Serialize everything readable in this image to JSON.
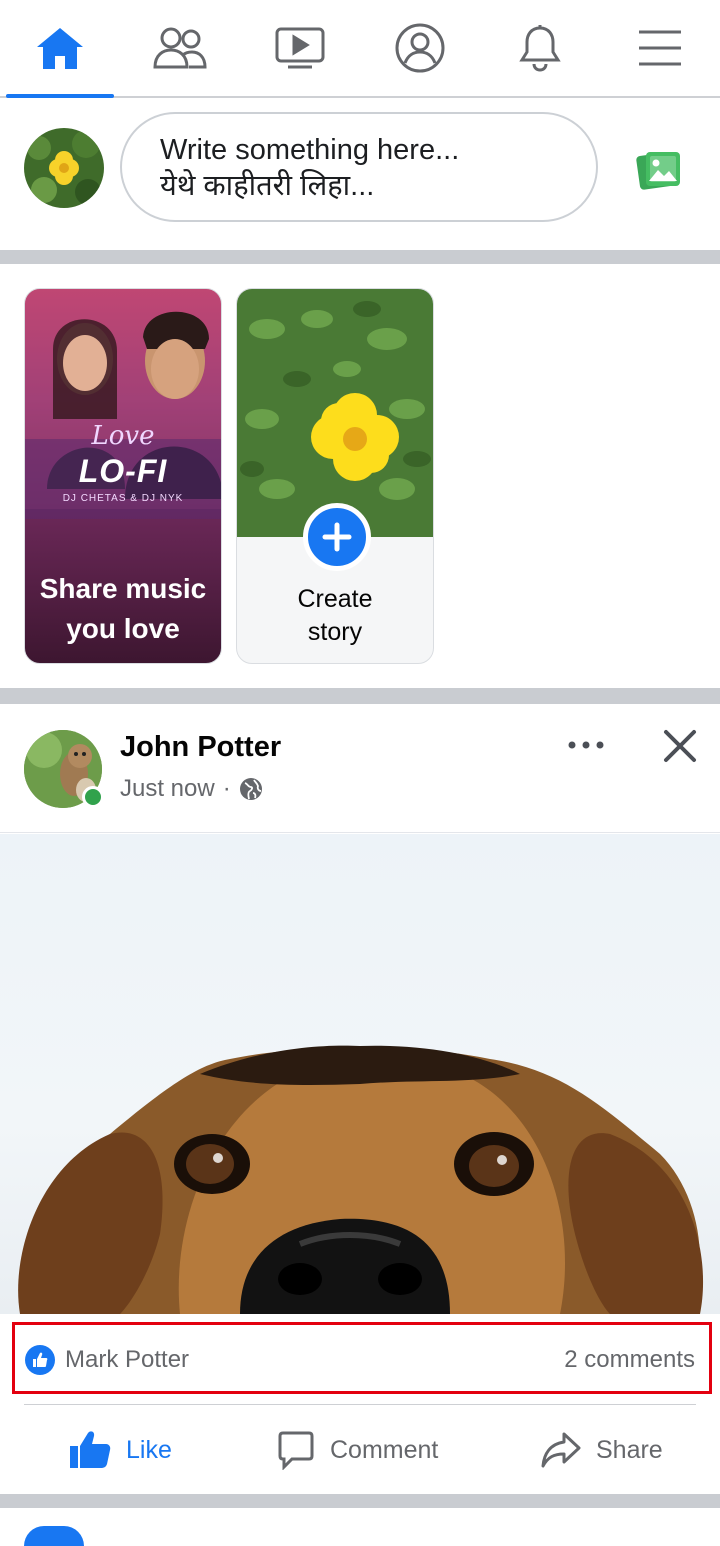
{
  "nav": {
    "tabs": [
      {
        "icon": "home-icon",
        "active": true
      },
      {
        "icon": "friends-icon",
        "active": false
      },
      {
        "icon": "watch-icon",
        "active": false
      },
      {
        "icon": "profile-icon",
        "active": false
      },
      {
        "icon": "notifications-icon",
        "active": false
      },
      {
        "icon": "menu-icon",
        "active": false
      }
    ]
  },
  "composer": {
    "placeholder_line1": "Write something here...",
    "placeholder_line2": "येथे काहीतरी लिहा..."
  },
  "stories": {
    "music_card": {
      "title_line1": "Share music",
      "title_line2": "you love",
      "poster_title": "Love",
      "poster_sub": "LO-FI",
      "poster_credit": "DJ CHETAS & DJ NYK"
    },
    "create_card": {
      "label_line1": "Create",
      "label_line2": "story"
    }
  },
  "post": {
    "author": "John Potter",
    "time": "Just now",
    "separator": "·",
    "privacy_icon": "globe-icon",
    "reactions": {
      "name": "Mark Potter",
      "comments": "2 comments"
    },
    "actions": {
      "like": "Like",
      "comment": "Comment",
      "share": "Share"
    }
  },
  "colors": {
    "accent": "#1877f2",
    "highlight_box": "#e3000f",
    "photo_green": "#3aa757",
    "online": "#31a24c"
  }
}
